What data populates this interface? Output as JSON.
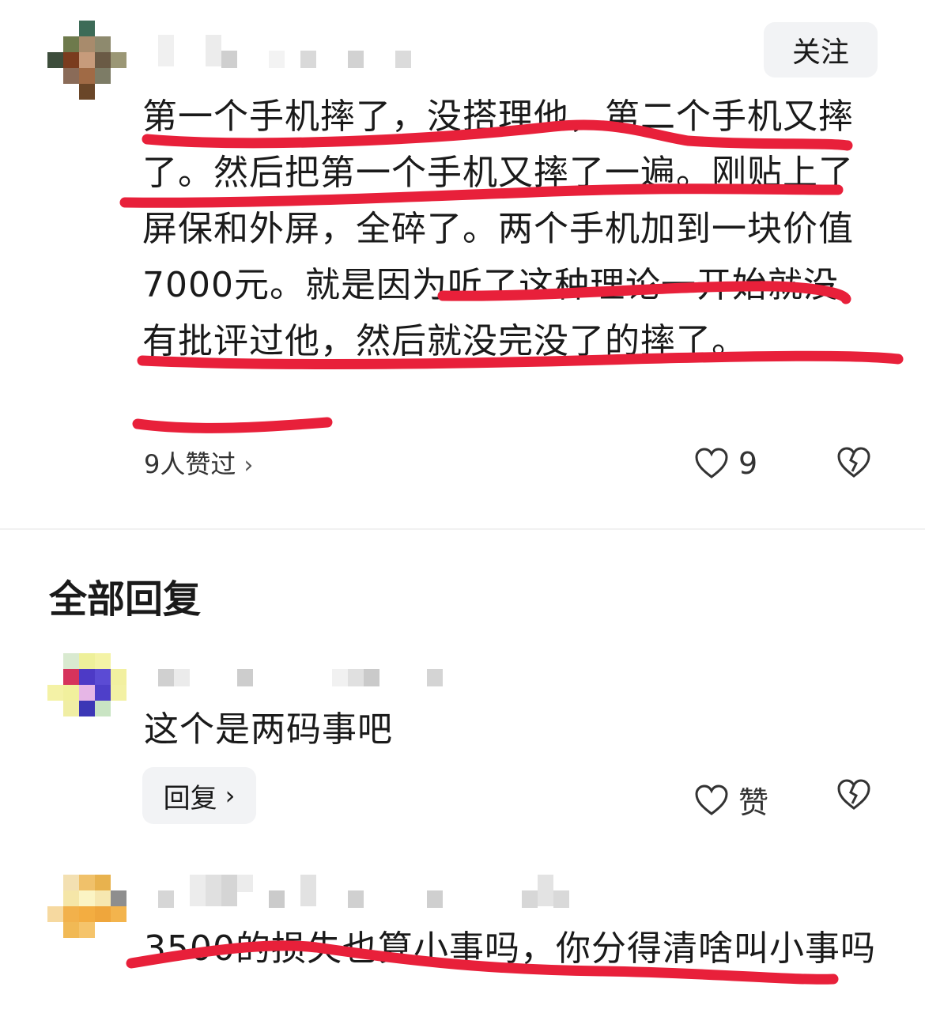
{
  "post": {
    "follow_label": "关注",
    "text": "第一个手机摔了，没搭理他，第二个手机又摔了。然后把第一个手机又摔了一遍。刚贴上了屏保和外屏，全碎了。两个手机加到一块价值7000元。就是因为听了这种理论一开始就没有批评过他，然后就没完没了的摔了。",
    "likes_link": "9人赞过",
    "like_count": "9"
  },
  "replies_section": {
    "title": "全部回复"
  },
  "replies": [
    {
      "text": "这个是两码事吧",
      "reply_button": "回复",
      "like_label": "赞"
    },
    {
      "text": "3500的损失也算小事吗，你分得清啥叫小事吗"
    }
  ],
  "colors": {
    "underline": "#e8203a",
    "button_bg": "#f2f3f5",
    "text": "#1a1a1a"
  },
  "icons": [
    "heart-icon",
    "broken-heart-icon",
    "chevron-right-icon"
  ]
}
